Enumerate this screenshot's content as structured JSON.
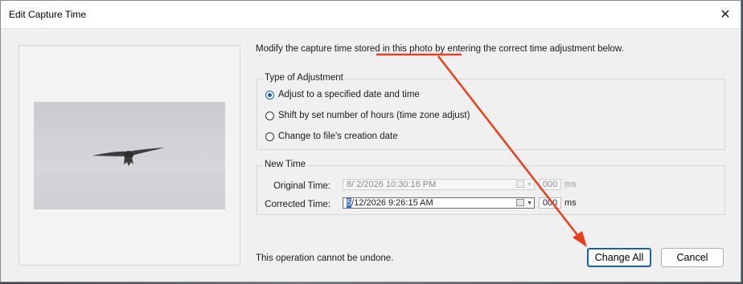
{
  "dialog": {
    "title": "Edit Capture Time",
    "close_glyph": "✕"
  },
  "instruction": "Modify the capture time stored in this photo by entering the correct time adjustment below.",
  "adjustment": {
    "legend": "Type of Adjustment",
    "options": [
      {
        "label": "Adjust to a specified date and time",
        "checked": true
      },
      {
        "label": "Shift by set number of hours (time zone adjust)",
        "checked": false
      },
      {
        "label": "Change to file's creation date",
        "checked": false
      }
    ]
  },
  "new_time": {
    "legend": "New Time",
    "original_label": "Original Time:",
    "original_value": "8/  2/2026 10:30:16 PM",
    "original_ms": "000",
    "corrected_label": "Corrected Time:",
    "corrected_selected": "5",
    "corrected_rest": "/12/2026   9:26:15 AM",
    "corrected_ms": "000",
    "ms_unit": "ms"
  },
  "warning": "This operation cannot be undone.",
  "buttons": {
    "change_all": "Change All",
    "cancel": "Cancel"
  },
  "colors": {
    "accent": "#1a5fb4",
    "annotation": "#e8401c"
  },
  "icons": {
    "calendar": "calendar-icon",
    "dropdown": "chevron-down-icon",
    "close": "close-icon"
  }
}
